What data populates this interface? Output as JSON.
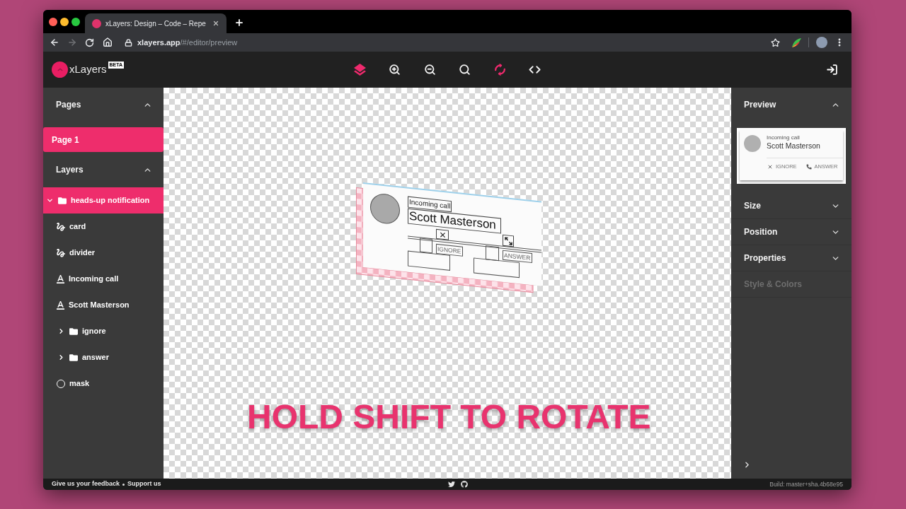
{
  "browser": {
    "tab": {
      "title": "xLayers: Design – Code – Repe"
    },
    "address": {
      "host": "xlayers.app",
      "path": "/#/editor/preview"
    },
    "forward_disabled": true
  },
  "header": {
    "logo": "xLayers",
    "badge": "BETA",
    "tools": [
      {
        "kind": "layers",
        "active": true
      },
      {
        "kind": "zoom_in",
        "active": false
      },
      {
        "kind": "zoom_out",
        "active": false
      },
      {
        "kind": "zoom_reset",
        "active": false
      },
      {
        "kind": "rotate_3d",
        "active": true
      },
      {
        "kind": "code",
        "active": false
      }
    ]
  },
  "left_sidebar": {
    "pages": {
      "title": "Pages",
      "expanded": true,
      "items": [
        {
          "label": "Page 1",
          "selected": true
        }
      ]
    },
    "layers": {
      "title": "Layers",
      "expanded": true,
      "items": [
        {
          "label": "heads-up notification",
          "kind": "folder",
          "expanded": true,
          "selected": true,
          "children": [
            {
              "label": "card",
              "kind": "shape",
              "selected": false
            },
            {
              "label": "divider",
              "kind": "shape",
              "selected": false
            },
            {
              "label": "Incoming call",
              "kind": "text",
              "selected": false
            },
            {
              "label": "Scott Masterson",
              "kind": "text",
              "selected": false
            },
            {
              "label": "ignore",
              "kind": "folder",
              "expanded": false,
              "selected": false
            },
            {
              "label": "answer",
              "kind": "folder",
              "expanded": false,
              "selected": false
            },
            {
              "label": "mask",
              "kind": "oval",
              "selected": false
            }
          ]
        }
      ]
    }
  },
  "canvas": {
    "artboard": {
      "subtitle": "Incoming call",
      "name": "Scott Masterson",
      "buttons": [
        {
          "kind": "dismiss",
          "label": "IGNORE"
        },
        {
          "kind": "call",
          "label": "ANSWER"
        }
      ]
    },
    "hint": "HOLD SHIFT TO ROTATE"
  },
  "right_panel": {
    "sections": [
      {
        "title": "Preview",
        "expanded": true,
        "card": {
          "subtitle": "Incoming call",
          "name": "Scott Masterson",
          "actions": [
            {
              "kind": "dismiss",
              "label": "IGNORE"
            },
            {
              "kind": "call",
              "label": "ANSWER"
            }
          ]
        }
      },
      {
        "title": "Size",
        "expanded": false
      },
      {
        "title": "Position",
        "expanded": false
      },
      {
        "title": "Properties",
        "expanded": false
      },
      {
        "title": "Style & Colors",
        "disabled": true
      }
    ]
  },
  "footer": {
    "links": [
      {
        "label": "Give us your feedback"
      },
      {
        "label": "Support us"
      }
    ],
    "build": "Build: master+sha.4b68e95"
  }
}
